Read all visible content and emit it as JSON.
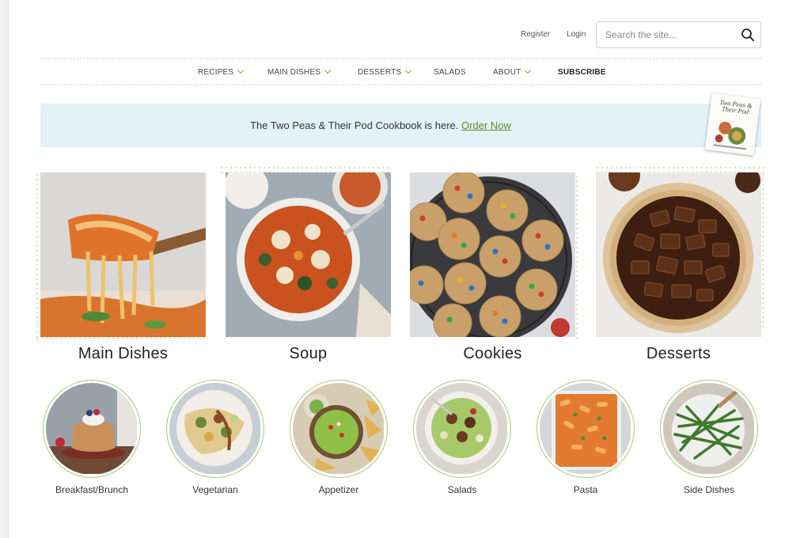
{
  "header": {
    "register": "Register",
    "login": "Login",
    "search_placeholder": "Search the site...",
    "icon": "search-icon"
  },
  "nav": {
    "recipes": "RECIPES",
    "main_dishes": "MAIN DISHES",
    "desserts": "DESSERTS",
    "salads": "SALADS",
    "about": "ABOUT",
    "subscribe": "SUBSCRIBE",
    "accent_color": "#7fad3f"
  },
  "banner": {
    "text": "The Two Peas & Their Pod Cookbook is here.",
    "link": "Order Now",
    "book_title": "Two Peas & Their Pod",
    "bg_color": "#e2f2f7"
  },
  "categories": [
    {
      "label": "Main Dishes"
    },
    {
      "label": "Soup"
    },
    {
      "label": "Cookies"
    },
    {
      "label": "Desserts"
    }
  ],
  "subcategories": [
    {
      "label": "Breakfast/Brunch"
    },
    {
      "label": "Vegetarian"
    },
    {
      "label": "Appetizer"
    },
    {
      "label": "Salads"
    },
    {
      "label": "Pasta"
    },
    {
      "label": "Side Dishes"
    }
  ]
}
